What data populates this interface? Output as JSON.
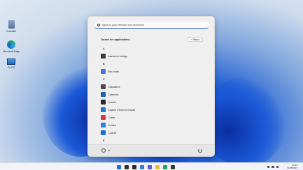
{
  "desktop": {
    "icons": [
      {
        "label": "Corbeille",
        "icon": "recycle-bin-icon"
      },
      {
        "label": "Microsoft Edge",
        "icon": "edge-icon"
      },
      {
        "label": "Ce PC",
        "icon": "computer-icon"
      }
    ]
  },
  "start_menu": {
    "search_placeholder": "Tapez ici pour effectuer une recherche",
    "all_apps_title": "Toutes les applications",
    "back_label": "Retour",
    "apps": [
      {
        "type": "letter",
        "label": "A"
      },
      {
        "type": "app",
        "label": "Alarmes et horloge",
        "icon": "alarm-clock-icon",
        "color": "#3a3a3a"
      },
      {
        "type": "letter",
        "label": "B"
      },
      {
        "type": "app",
        "label": "Bloc-notes",
        "icon": "notepad-icon",
        "color": "#3b7bd6"
      },
      {
        "type": "letter",
        "label": "C"
      },
      {
        "type": "app",
        "label": "Calculatrice",
        "icon": "calculator-icon",
        "color": "#4a4a4a"
      },
      {
        "type": "app",
        "label": "Calendrier",
        "icon": "calendar-icon",
        "color": "#1e5fb8"
      },
      {
        "type": "app",
        "label": "Caméra",
        "icon": "camera-icon",
        "color": "#2a2a2a"
      },
      {
        "type": "app",
        "label": "Capture d'écran et croquis",
        "icon": "snip-icon",
        "color": "#2b72d6"
      },
      {
        "type": "app",
        "label": "Cartes",
        "icon": "maps-icon",
        "color": "#d63b3b"
      },
      {
        "type": "app",
        "label": "Cortana",
        "icon": "cortana-icon",
        "color": "#2f82e0"
      },
      {
        "type": "app",
        "label": "Courrier",
        "icon": "mail-icon",
        "color": "#1f6fd1"
      },
      {
        "type": "letter",
        "label": "E"
      }
    ],
    "user_label": "sv"
  },
  "taskbar": {
    "icons": [
      {
        "name": "start-icon",
        "color": "#1f6fd6"
      },
      {
        "name": "search-icon",
        "color": "#333333"
      },
      {
        "name": "task-view-icon",
        "color": "#2b2b2b"
      },
      {
        "name": "widgets-icon",
        "color": "#2f7fd9"
      },
      {
        "name": "chat-icon",
        "color": "#5b5fc7"
      },
      {
        "name": "file-explorer-icon",
        "color": "#e9b736"
      },
      {
        "name": "edge-icon",
        "color": "#1fa45b"
      },
      {
        "name": "store-icon",
        "color": "#3a3a3a"
      }
    ],
    "time": "19:13",
    "date": "12/05/2023"
  }
}
